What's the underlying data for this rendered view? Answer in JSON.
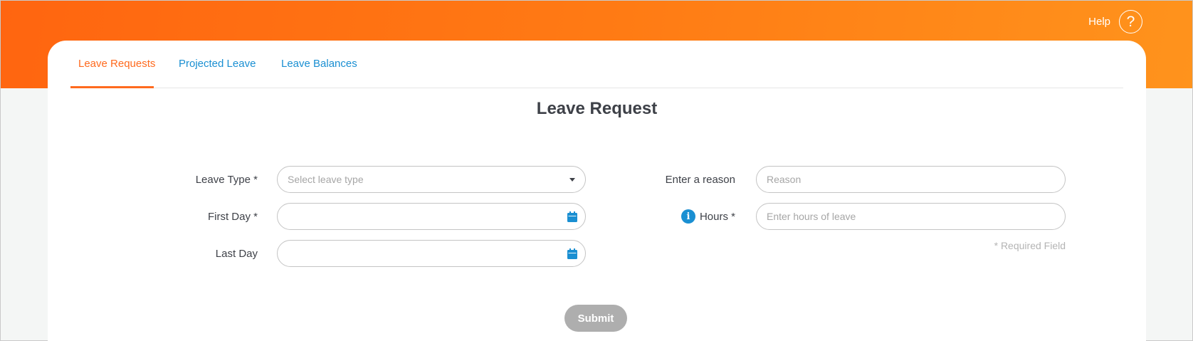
{
  "header": {
    "help_label": "Help",
    "help_glyph": "?"
  },
  "tabs": [
    {
      "label": "Leave Requests",
      "active": true
    },
    {
      "label": "Projected Leave",
      "active": false
    },
    {
      "label": "Leave Balances",
      "active": false
    }
  ],
  "page_title": "Leave Request",
  "form": {
    "leave_type": {
      "label": "Leave Type",
      "required_mark": "*",
      "placeholder": "Select leave type"
    },
    "first_day": {
      "label": "First Day",
      "required_mark": "*",
      "value": ""
    },
    "last_day": {
      "label": "Last Day",
      "value": ""
    },
    "reason": {
      "label": "Enter a reason",
      "placeholder": "Reason"
    },
    "hours": {
      "label": "Hours",
      "required_mark": "*",
      "placeholder": "Enter hours of leave"
    },
    "required_note": "* Required Field",
    "submit_label": "Submit"
  },
  "colors": {
    "accent": "#ff6a1e",
    "link": "#1a8fd2",
    "button_disabled": "#aeaeae"
  }
}
